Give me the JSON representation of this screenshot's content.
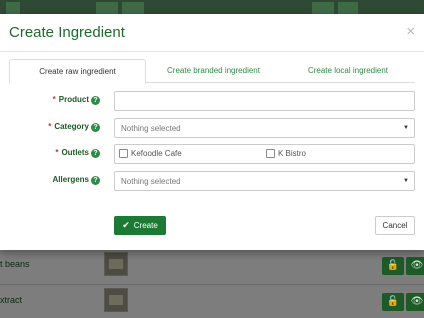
{
  "modal": {
    "title": "Create Ingredient",
    "close_label": "×"
  },
  "tabs": [
    {
      "label": "Create raw ingredient",
      "active": true
    },
    {
      "label": "Create branded ingredient",
      "active": false
    },
    {
      "label": "Create local ingredient",
      "active": false
    }
  ],
  "form": {
    "required_mark": "*",
    "product": {
      "label": "Product",
      "value": "",
      "placeholder": ""
    },
    "category": {
      "label": "Category",
      "selected": "Nothing selected"
    },
    "outlets": {
      "label": "Outlets",
      "options": [
        "Kefoodle Cafe",
        "K Bistro"
      ]
    },
    "allergens": {
      "label": "Allergens",
      "selected": "Nothing selected"
    }
  },
  "buttons": {
    "create": "Create",
    "cancel": "Cancel"
  },
  "background_list": {
    "rows": [
      {
        "label": "t beans"
      },
      {
        "label": "xtract"
      }
    ]
  },
  "icons": {
    "help": "question-circle-icon",
    "check": "check-icon",
    "close": "close-icon",
    "lock": "lock-icon",
    "eye": "eye-icon",
    "caret": "caret-down-icon"
  },
  "colors": {
    "brand_green": "#1d7a34",
    "title_green": "#1d6b2c",
    "required_red": "#c0392b"
  }
}
